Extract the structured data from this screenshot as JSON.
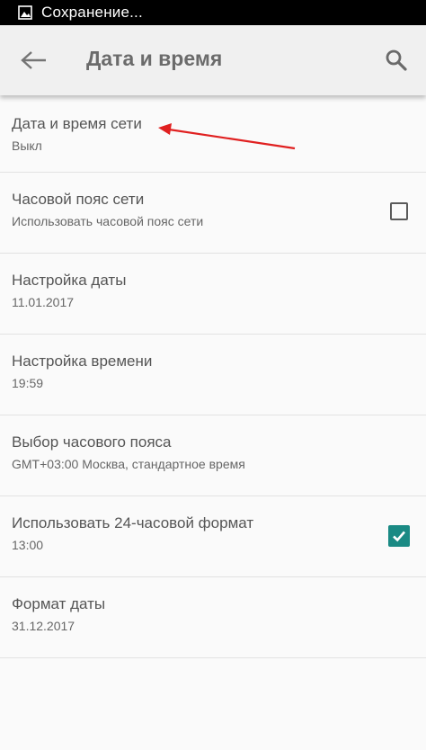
{
  "status_bar": {
    "icon": "image-icon",
    "text": "Сохранение..."
  },
  "toolbar": {
    "back_icon": "arrow-back-icon",
    "title": "Дата и время",
    "search_icon": "search-icon"
  },
  "settings": [
    {
      "label": "Дата и время сети",
      "value": "Выкл"
    },
    {
      "label": "Часовой пояс сети",
      "value": "Использовать часовой пояс сети",
      "checkbox": false
    },
    {
      "label": "Настройка даты",
      "value": "11.01.2017"
    },
    {
      "label": "Настройка времени",
      "value": "19:59"
    },
    {
      "label": "Выбор часового пояса",
      "value": "GMT+03:00 Москва, стандартное время"
    },
    {
      "label": "Использовать 24-часовой формат",
      "value": "13:00",
      "checkbox": true
    },
    {
      "label": "Формат даты",
      "value": "31.12.2017"
    }
  ],
  "colors": {
    "accent": "#1a8a84",
    "annotation_arrow": "#e02020",
    "toolbar_bg": "#f0f0f0",
    "status_bar_bg": "#000000"
  },
  "annotation": {
    "type": "arrow",
    "points_to": "Дата и время сети"
  }
}
